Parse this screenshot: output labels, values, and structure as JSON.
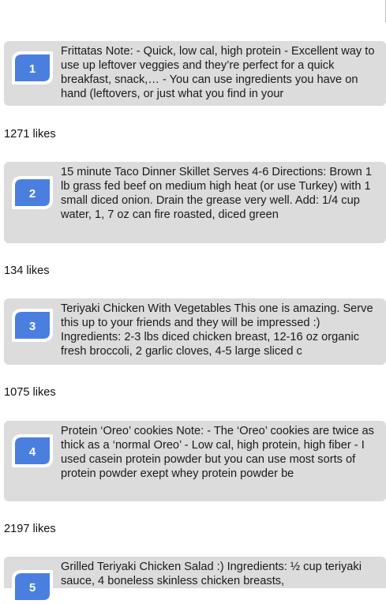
{
  "posts": [
    {
      "number": "1",
      "text": "Frittatas Note: - Quick, low cal, high protein - Excellent way to use up leftover veggies and they’re perfect for a quick breakfast, snack,… - You can use ingredients you have on hand (leftovers, or just what you find in your",
      "likes": "1271 likes"
    },
    {
      "number": "2",
      "text": "15 minute Taco Dinner Skillet Serves 4-6 Directions: Brown 1 lb grass fed beef on medium high heat (or use Turkey) with 1 small diced onion. Drain the grease very well. Add: 1/4 cup water, 1, 7 oz can fire roasted, diced green",
      "likes": "134 likes"
    },
    {
      "number": "3",
      "text": "Teriyaki Chicken With Vegetables This one is amazing. Serve this up to your friends and they will be impressed :) Ingredients: 2-3 lbs diced chicken breast, 12-16 oz organic fresh broccoli, 2 garlic cloves, 4-5 large sliced c",
      "likes": "1075 likes"
    },
    {
      "number": "4",
      "text": "Protein ‘Oreo’ cookies Note: - The ‘Oreo’ cookies are twice as thick as a ‘normal Oreo’ - Low cal, high protein, high fiber - I used casein protein powder but you can use most sorts of protein powder exept whey protein powder be",
      "likes": "2197 likes"
    },
    {
      "number": "5",
      "text": "Grilled Teriyaki Chicken Salad :) Ingredients: ½ cup teriyaki sauce, 4 boneless skinless chicken breasts,"
    }
  ],
  "colors": {
    "card_bg": "#dcdcdc",
    "badge_blue": "#4a7fe0",
    "badge_outline": "#ffffff"
  },
  "icons": {
    "badge": "leaf-badge-icon"
  }
}
